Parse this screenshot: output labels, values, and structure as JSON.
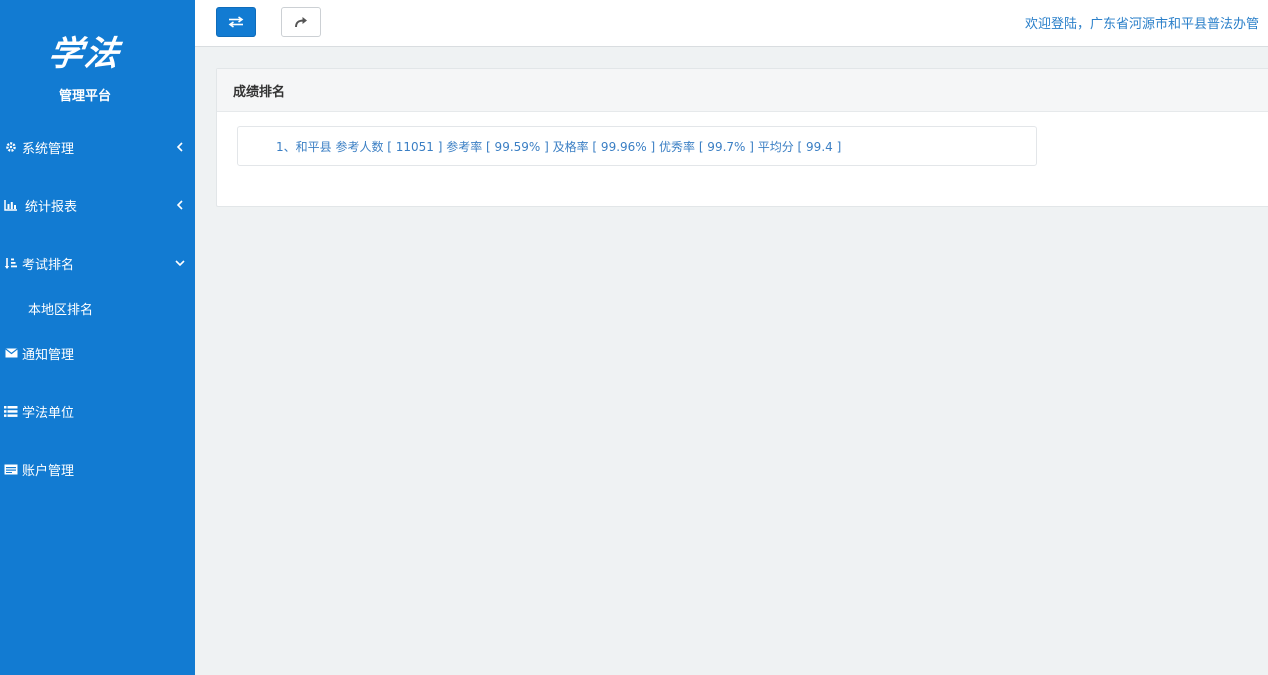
{
  "sidebar": {
    "logo_title": "学法",
    "logo_subtitle": "管理平台",
    "items": [
      {
        "label": "系统管理"
      },
      {
        "label": "统计报表"
      },
      {
        "label": "考试排名"
      },
      {
        "label": "通知管理"
      },
      {
        "label": "学法单位"
      },
      {
        "label": "账户管理"
      }
    ],
    "subitem_label": "本地区排名"
  },
  "topbar": {
    "welcome": "欢迎登陆，广东省河源市和平县普法办管"
  },
  "panel": {
    "title": "成绩排名",
    "rank_line": "1、和平县 参考人数 [ 11051 ] 参考率 [ 99.59% ] 及格率 [ 99.96% ] 优秀率 [ 99.7% ] 平均分 [ 99.4 ]"
  },
  "colors": {
    "sidebar_bg": "#127bd2",
    "accent": "#127bd2",
    "link": "#3b7fc4",
    "page_bg": "#eff2f3"
  },
  "icons": {
    "item0": "gear-icon",
    "item1": "bar-chart-icon",
    "item2": "sort-amount-icon",
    "item3": "envelope-icon",
    "item4": "list-icon",
    "item5": "id-card-icon"
  }
}
